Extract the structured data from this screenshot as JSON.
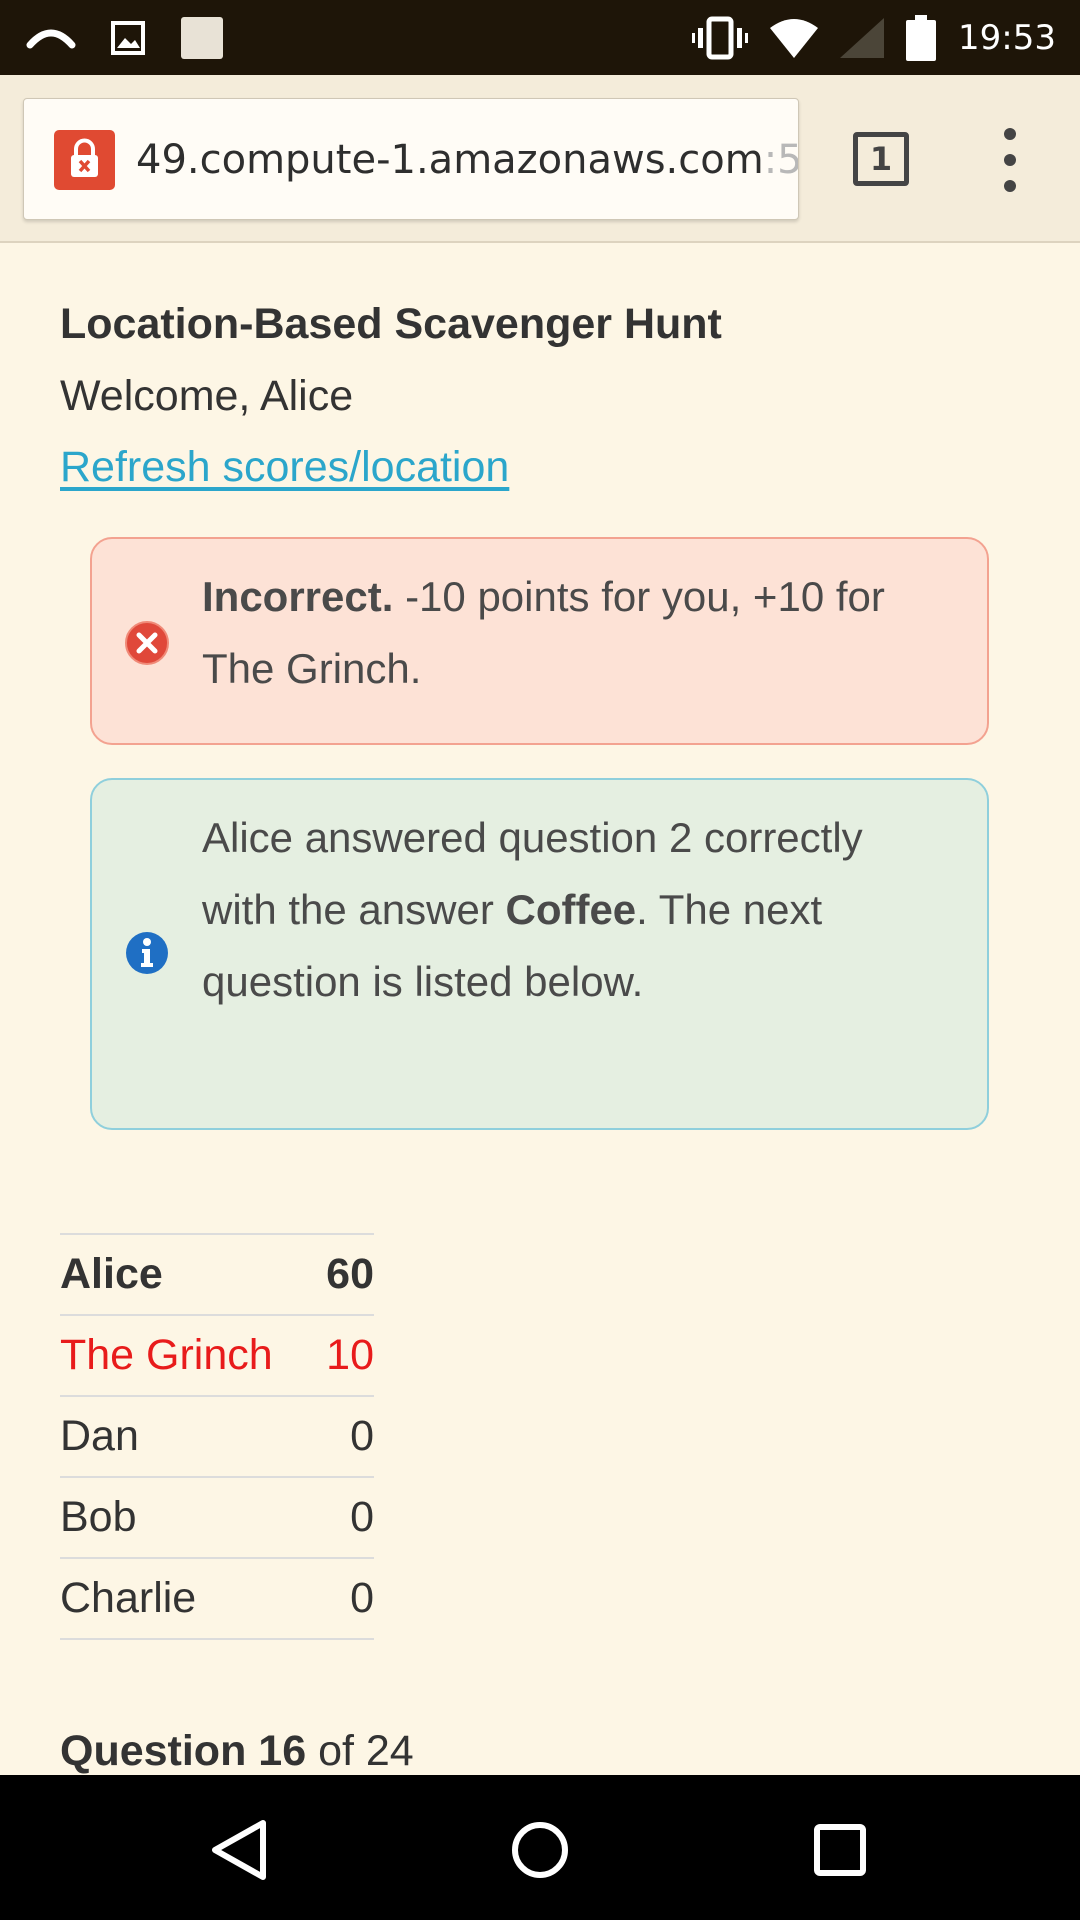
{
  "status_bar": {
    "time": "19:53",
    "left_icons": [
      "missed-call-icon",
      "image-icon",
      "notification-icon"
    ],
    "right_icons": [
      "vibrate-icon",
      "wifi-icon",
      "signal-icon",
      "battery-icon"
    ]
  },
  "browser": {
    "url_main": "49.compute-1.amazonaws.com",
    "url_fade": ":5",
    "tab_count": "1",
    "lock_color": "#e04a32"
  },
  "page": {
    "title": "Location-Based Scavenger Hunt",
    "welcome": "Welcome, Alice",
    "refresh_link": "Refresh scores/location",
    "link_color": "#2ba6cb"
  },
  "alerts": {
    "error": {
      "strong": "Incorrect.",
      "text": " -10 points for you, +10 for The Grinch."
    },
    "info": {
      "before": "Alice answered question 2 correctly with the answer ",
      "strong": "Coffee",
      "after": ". The next question is listed below."
    }
  },
  "scores": [
    {
      "name": "Alice",
      "score": "60"
    },
    {
      "name": "The Grinch",
      "score": "10"
    },
    {
      "name": "Dan",
      "score": "0"
    },
    {
      "name": "Bob",
      "score": "0"
    },
    {
      "name": "Charlie",
      "score": "0"
    }
  ],
  "question": {
    "label": "Question 16",
    "rest": " of 24"
  }
}
